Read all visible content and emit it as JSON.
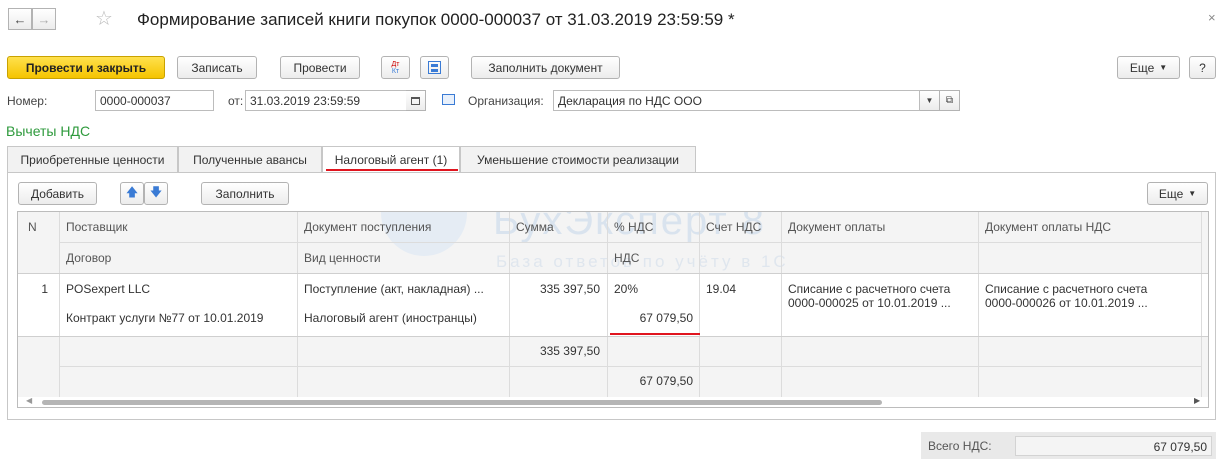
{
  "window": {
    "title": "Формирование записей книги покупок 0000-000037 от 31.03.2019 23:59:59 *"
  },
  "toolbar": {
    "post_close_label": "Провести и закрыть",
    "save_label": "Записать",
    "post_label": "Провести",
    "dt_kt_label": "Дт Кт",
    "fill_document_label": "Заполнить документ",
    "more_label": "Еще",
    "help_label": "?"
  },
  "header": {
    "number_label": "Номер:",
    "number_value": "0000-000037",
    "date_label": "от:",
    "date_value": "31.03.2019 23:59:59",
    "org_label": "Организация:",
    "org_value": "Декларация по НДС ООО"
  },
  "section_title": "Вычеты НДС",
  "tabs": [
    {
      "label": "Приобретенные ценности"
    },
    {
      "label": "Полученные авансы"
    },
    {
      "label": "Налоговый агент (1)"
    },
    {
      "label": "Уменьшение стоимости реализации"
    }
  ],
  "table_toolbar": {
    "add_label": "Добавить",
    "fill_label": "Заполнить",
    "more_label": "Еще"
  },
  "watermark": {
    "brand": "БухЭксперт 8",
    "sub": "База ответов по учёту в 1С"
  },
  "table": {
    "headers_row1": {
      "n": "N",
      "supplier": "Поставщик",
      "receipt_doc": "Документ поступления",
      "amount": "Сумма",
      "vat_rate": "% НДС",
      "vat_account": "Счет НДС",
      "payment_doc": "Документ оплаты",
      "vat_payment_doc": "Документ оплаты НДС"
    },
    "headers_row2": {
      "contract": "Договор",
      "asset_type": "Вид ценности",
      "vat": "НДС"
    },
    "rows": [
      {
        "n": "1",
        "supplier": "POSexpert LLC",
        "contract": "Контракт услуги №77 от 10.01.2019",
        "receipt_doc": "Поступление (акт, накладная) ...",
        "asset_type": "Налоговый агент (иностранцы)",
        "amount": "335 397,50",
        "vat_rate": "20%",
        "vat": "67 079,50",
        "vat_account": "19.04",
        "payment_doc_line1": "Списание с расчетного счета",
        "payment_doc_line2": "0000-000025 от 10.01.2019 ...",
        "vat_payment_doc_line1": "Списание с расчетного счета",
        "vat_payment_doc_line2": "0000-000026 от 10.01.2019 ..."
      }
    ],
    "totals": {
      "amount": "335 397,50",
      "vat": "67 079,50"
    }
  },
  "footer": {
    "total_vat_label": "Всего НДС:",
    "total_vat_value": "67 079,50"
  },
  "colors": {
    "primary_button": "#f5c400",
    "section_title": "#2e9a3c",
    "highlight_underline": "#e0141e",
    "arrow_blue": "#3a7bd5"
  }
}
